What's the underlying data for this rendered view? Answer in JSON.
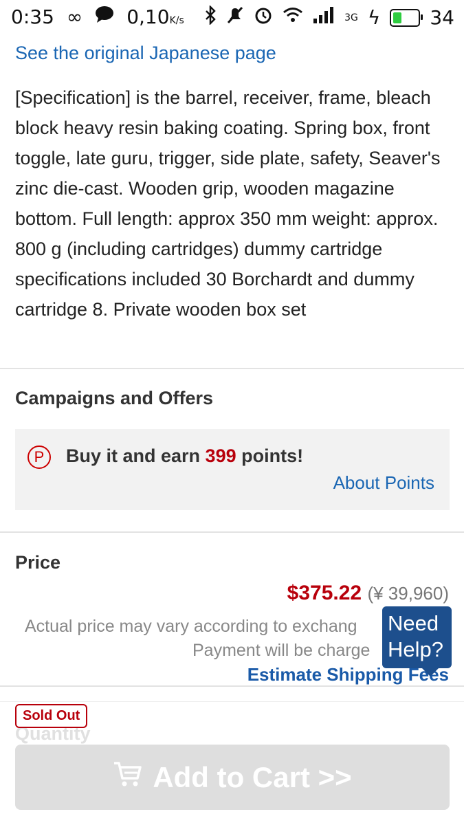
{
  "status_bar": {
    "time": "0:35",
    "speed": "0,10",
    "speed_unit": "K/s",
    "network_type": "3G",
    "battery": "34",
    "icons": [
      "infinity-icon",
      "chat-bubble-icon",
      "bluetooth-icon",
      "muted-bell-icon",
      "alarm-icon",
      "wifi-icon",
      "signal-icon",
      "charging-icon",
      "battery-icon"
    ]
  },
  "product": {
    "original_link": "See the original Japanese page",
    "description": "[Specification] is the barrel, receiver, frame, bleach block heavy resin baking coating. Spring box, front toggle, late guru, trigger, side plate, safety, Seaver's zinc die-cast. Wooden grip, wooden magazine bottom. Full length: approx 350 mm weight: approx. 800 g (including cartridges) dummy cartridge specifications included 30 Borchardt and dummy cartridge 8. Private wooden box set"
  },
  "campaigns": {
    "title": "Campaigns and Offers",
    "badge": "P",
    "offer_prefix": "Buy it and earn ",
    "points": "399",
    "offer_suffix": " points!",
    "about_link": "About Points"
  },
  "price": {
    "title": "Price",
    "usd": "$375.22",
    "jpy": "(¥ 39,960)",
    "note_line1": "Actual price may vary according to exchang",
    "note_line2": "Payment will be charge",
    "shipping_link": "Estimate Shipping Fees"
  },
  "help": {
    "label_line1": "Need",
    "label_line2": "Help?"
  },
  "purchase": {
    "sold_out_badge": "Sold Out",
    "quantity_label": "Quantity",
    "cart_button": "Add to Cart >>"
  },
  "colors": {
    "accent_link": "#1a66b3",
    "price_red": "#b8000b",
    "help_blue": "#1d4f8d",
    "disabled_button": "#dedede"
  }
}
